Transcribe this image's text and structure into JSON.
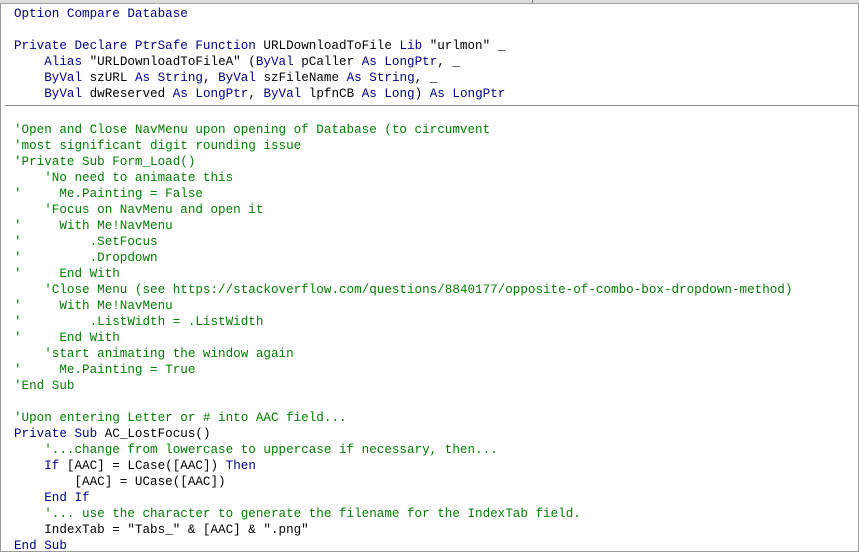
{
  "code_lines": [
    {
      "n": 0,
      "s": [
        {
          "t": "k",
          "v": "Option Compare Database"
        }
      ]
    },
    {
      "n": 2,
      "s": [
        {
          "t": "k",
          "v": "Private Declare PtrSafe Function "
        },
        {
          "t": "p",
          "v": "URLDownloadToFile "
        },
        {
          "t": "k",
          "v": "Lib "
        },
        {
          "t": "p",
          "v": "\"urlmon\" _"
        }
      ]
    },
    {
      "n": 3,
      "s": [
        {
          "t": "p",
          "v": "    "
        },
        {
          "t": "k",
          "v": "Alias "
        },
        {
          "t": "p",
          "v": "\"URLDownloadToFileA\" ("
        },
        {
          "t": "k",
          "v": "ByVal "
        },
        {
          "t": "p",
          "v": "pCaller "
        },
        {
          "t": "k",
          "v": "As LongPtr"
        },
        {
          "t": "p",
          "v": ", _"
        }
      ]
    },
    {
      "n": 4,
      "s": [
        {
          "t": "p",
          "v": "    "
        },
        {
          "t": "k",
          "v": "ByVal "
        },
        {
          "t": "p",
          "v": "szURL "
        },
        {
          "t": "k",
          "v": "As String"
        },
        {
          "t": "p",
          "v": ", "
        },
        {
          "t": "k",
          "v": "ByVal "
        },
        {
          "t": "p",
          "v": "szFileName "
        },
        {
          "t": "k",
          "v": "As String"
        },
        {
          "t": "p",
          "v": ", _"
        }
      ]
    },
    {
      "n": 5,
      "s": [
        {
          "t": "p",
          "v": "    "
        },
        {
          "t": "k",
          "v": "ByVal "
        },
        {
          "t": "p",
          "v": "dwReserved "
        },
        {
          "t": "k",
          "v": "As LongPtr"
        },
        {
          "t": "p",
          "v": ", "
        },
        {
          "t": "k",
          "v": "ByVal "
        },
        {
          "t": "p",
          "v": "lpfnCB "
        },
        {
          "t": "k",
          "v": "As Long"
        },
        {
          "t": "p",
          "v": ") "
        },
        {
          "t": "k",
          "v": "As LongPtr"
        }
      ]
    },
    {
      "n": 7,
      "s": [
        {
          "t": "c",
          "v": "'Open and Close NavMenu upon opening of Database (to circumvent"
        }
      ]
    },
    {
      "n": 8,
      "s": [
        {
          "t": "c",
          "v": "'most significant digit rounding issue"
        }
      ]
    },
    {
      "n": 9,
      "s": [
        {
          "t": "c",
          "v": "'Private Sub Form_Load()"
        }
      ]
    },
    {
      "n": 10,
      "s": [
        {
          "t": "c",
          "v": "    'No need to animaate this"
        }
      ]
    },
    {
      "n": 11,
      "s": [
        {
          "t": "c",
          "v": "'     Me.Painting = False"
        }
      ]
    },
    {
      "n": 12,
      "s": [
        {
          "t": "c",
          "v": "    'Focus on NavMenu and open it"
        }
      ]
    },
    {
      "n": 13,
      "s": [
        {
          "t": "c",
          "v": "'     With Me!NavMenu"
        }
      ]
    },
    {
      "n": 14,
      "s": [
        {
          "t": "c",
          "v": "'         .SetFocus"
        }
      ]
    },
    {
      "n": 15,
      "s": [
        {
          "t": "c",
          "v": "'         .Dropdown"
        }
      ]
    },
    {
      "n": 16,
      "s": [
        {
          "t": "c",
          "v": "'     End With"
        }
      ]
    },
    {
      "n": 17,
      "s": [
        {
          "t": "c",
          "v": "    'Close Menu (see https://stackoverflow.com/questions/8840177/opposite-of-combo-box-dropdown-method)"
        }
      ]
    },
    {
      "n": 18,
      "s": [
        {
          "t": "c",
          "v": "'     With Me!NavMenu"
        }
      ]
    },
    {
      "n": 19,
      "s": [
        {
          "t": "c",
          "v": "'         .ListWidth = .ListWidth"
        }
      ]
    },
    {
      "n": 20,
      "s": [
        {
          "t": "c",
          "v": "'     End With"
        }
      ]
    },
    {
      "n": 21,
      "s": [
        {
          "t": "c",
          "v": "    'start animating the window again"
        }
      ]
    },
    {
      "n": 22,
      "s": [
        {
          "t": "c",
          "v": "'     Me.Painting = True"
        }
      ]
    },
    {
      "n": 23,
      "s": [
        {
          "t": "c",
          "v": "'End Sub"
        }
      ]
    },
    {
      "n": 25,
      "s": [
        {
          "t": "c",
          "v": "'Upon entering Letter or # into AAC field..."
        }
      ]
    },
    {
      "n": 26,
      "s": [
        {
          "t": "k",
          "v": "Private Sub "
        },
        {
          "t": "p",
          "v": "AC_LostFocus()"
        }
      ]
    },
    {
      "n": 27,
      "s": [
        {
          "t": "c",
          "v": "    '...change from lowercase to uppercase if necessary, then..."
        }
      ]
    },
    {
      "n": 28,
      "s": [
        {
          "t": "p",
          "v": "    "
        },
        {
          "t": "k",
          "v": "If "
        },
        {
          "t": "p",
          "v": "[AAC] = LCase([AAC]) "
        },
        {
          "t": "k",
          "v": "Then"
        }
      ]
    },
    {
      "n": 29,
      "s": [
        {
          "t": "p",
          "v": "        [AAC] = UCase([AAC])"
        }
      ]
    },
    {
      "n": 30,
      "s": [
        {
          "t": "p",
          "v": "    "
        },
        {
          "t": "k",
          "v": "End If"
        }
      ]
    },
    {
      "n": 31,
      "s": [
        {
          "t": "c",
          "v": "    '... use the character to generate the filename for the IndexTab field."
        }
      ]
    },
    {
      "n": 32,
      "s": [
        {
          "t": "p",
          "v": "    IndexTab = \"Tabs_\" & [AAC] & \".png\""
        }
      ]
    },
    {
      "n": 33,
      "s": [
        {
          "t": "k",
          "v": "End Sub"
        }
      ]
    }
  ],
  "colors": {
    "keyword": "#00008b",
    "comment": "#008000",
    "plain": "#000000",
    "separator": "#8c8c8c"
  }
}
